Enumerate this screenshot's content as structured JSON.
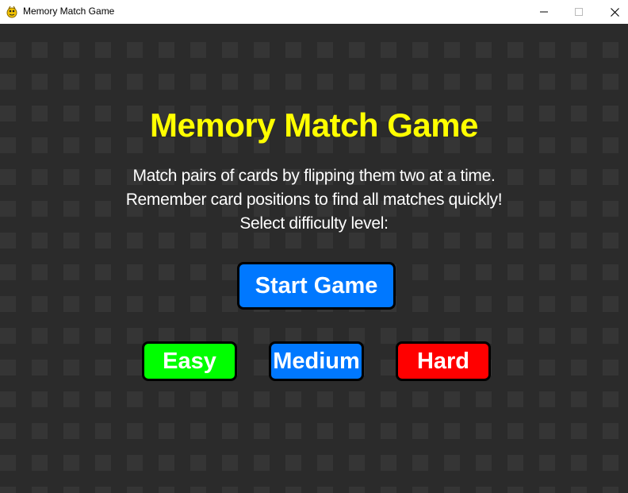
{
  "window": {
    "title": "Memory Match Game",
    "icon": "pygame-snake-icon",
    "controls": [
      "minimize-icon",
      "maximize-icon",
      "close-icon"
    ]
  },
  "game": {
    "background_color": "#2b2b2b",
    "tile_color": "#353535",
    "title": "Memory Match Game",
    "title_color": "#ffff00",
    "instructions": [
      "Match pairs of cards by flipping them two at a time.",
      "Remember card positions to find all matches quickly!",
      "Select difficulty level:"
    ],
    "start_button": {
      "label": "Start Game",
      "color": "#0078ff"
    },
    "difficulty_buttons": [
      {
        "label": "Easy",
        "color": "#00ff00"
      },
      {
        "label": "Medium",
        "color": "#0078ff"
      },
      {
        "label": "Hard",
        "color": "#ff0000"
      }
    ]
  }
}
